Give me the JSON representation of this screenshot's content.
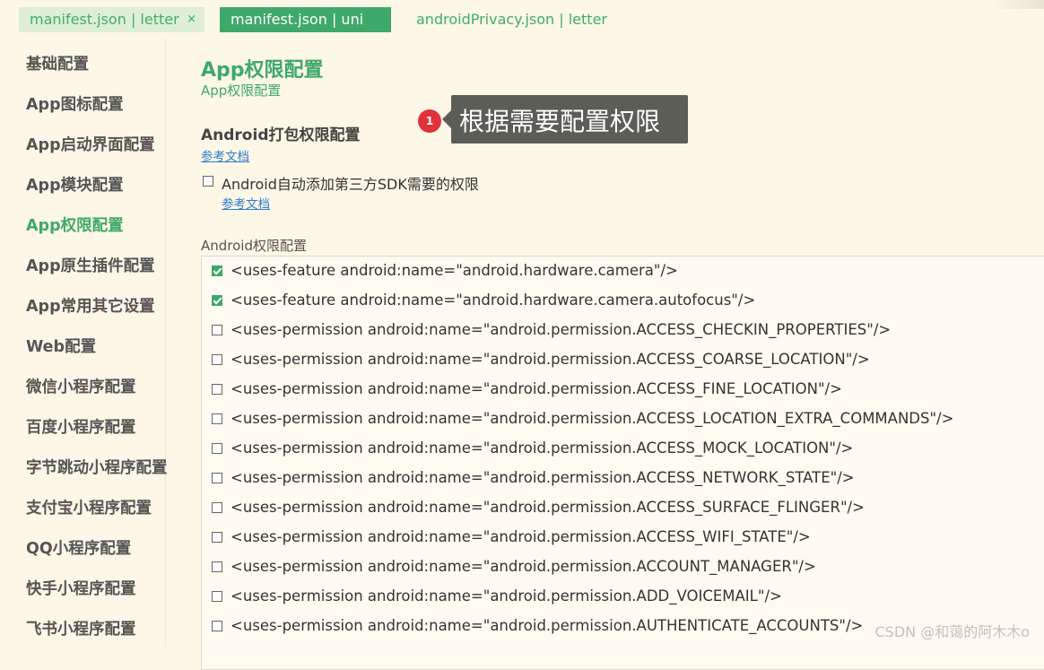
{
  "tabs": [
    {
      "label": "manifest.json | letter",
      "close": "×"
    },
    {
      "label": "manifest.json | uni"
    },
    {
      "label": "androidPrivacy.json | letter"
    }
  ],
  "sidebar": {
    "items": [
      {
        "label": "基础配置"
      },
      {
        "label": "App图标配置"
      },
      {
        "label": "App启动界面配置"
      },
      {
        "label": "App模块配置"
      },
      {
        "label": "App权限配置",
        "active": true
      },
      {
        "label": "App原生插件配置"
      },
      {
        "label": "App常用其它设置"
      },
      {
        "label": "Web配置"
      },
      {
        "label": "微信小程序配置"
      },
      {
        "label": "百度小程序配置"
      },
      {
        "label": "字节跳动小程序配置"
      },
      {
        "label": "支付宝小程序配置"
      },
      {
        "label": "QQ小程序配置"
      },
      {
        "label": "快手小程序配置"
      },
      {
        "label": "飞书小程序配置"
      }
    ]
  },
  "main": {
    "title": "App权限配置",
    "subtitle": "App权限配置",
    "android_pack": {
      "title": "Android打包权限配置",
      "doc_link": "参考文档",
      "auto_add_label": "Android自动添加第三方SDK需要的权限",
      "auto_add_checked": false,
      "auto_add_doc_link": "参考文档"
    },
    "permissions_label": "Android权限配置",
    "permissions": [
      {
        "text": "<uses-feature android:name=\"android.hardware.camera\"/>",
        "checked": true
      },
      {
        "text": "<uses-feature android:name=\"android.hardware.camera.autofocus\"/>",
        "checked": true
      },
      {
        "text": "<uses-permission android:name=\"android.permission.ACCESS_CHECKIN_PROPERTIES\"/>",
        "checked": false
      },
      {
        "text": "<uses-permission android:name=\"android.permission.ACCESS_COARSE_LOCATION\"/>",
        "checked": false
      },
      {
        "text": "<uses-permission android:name=\"android.permission.ACCESS_FINE_LOCATION\"/>",
        "checked": false
      },
      {
        "text": "<uses-permission android:name=\"android.permission.ACCESS_LOCATION_EXTRA_COMMANDS\"/>",
        "checked": false
      },
      {
        "text": "<uses-permission android:name=\"android.permission.ACCESS_MOCK_LOCATION\"/>",
        "checked": false
      },
      {
        "text": "<uses-permission android:name=\"android.permission.ACCESS_NETWORK_STATE\"/>",
        "checked": false
      },
      {
        "text": "<uses-permission android:name=\"android.permission.ACCESS_SURFACE_FLINGER\"/>",
        "checked": false
      },
      {
        "text": "<uses-permission android:name=\"android.permission.ACCESS_WIFI_STATE\"/>",
        "checked": false
      },
      {
        "text": "<uses-permission android:name=\"android.permission.ACCOUNT_MANAGER\"/>",
        "checked": false
      },
      {
        "text": "<uses-permission android:name=\"android.permission.ADD_VOICEMAIL\"/>",
        "checked": false
      },
      {
        "text": "<uses-permission android:name=\"android.permission.AUTHENTICATE_ACCOUNTS\"/>",
        "checked": false
      }
    ]
  },
  "annotation": {
    "badge": "1",
    "text": "根据需要配置权限"
  },
  "watermark": "CSDN @和蔼的阿木木o",
  "colors": {
    "accent": "#3ea96a",
    "background": "#fdf7e7",
    "link": "#2e7bcf",
    "badge": "#e0323a",
    "callout": "#5d5d58"
  }
}
